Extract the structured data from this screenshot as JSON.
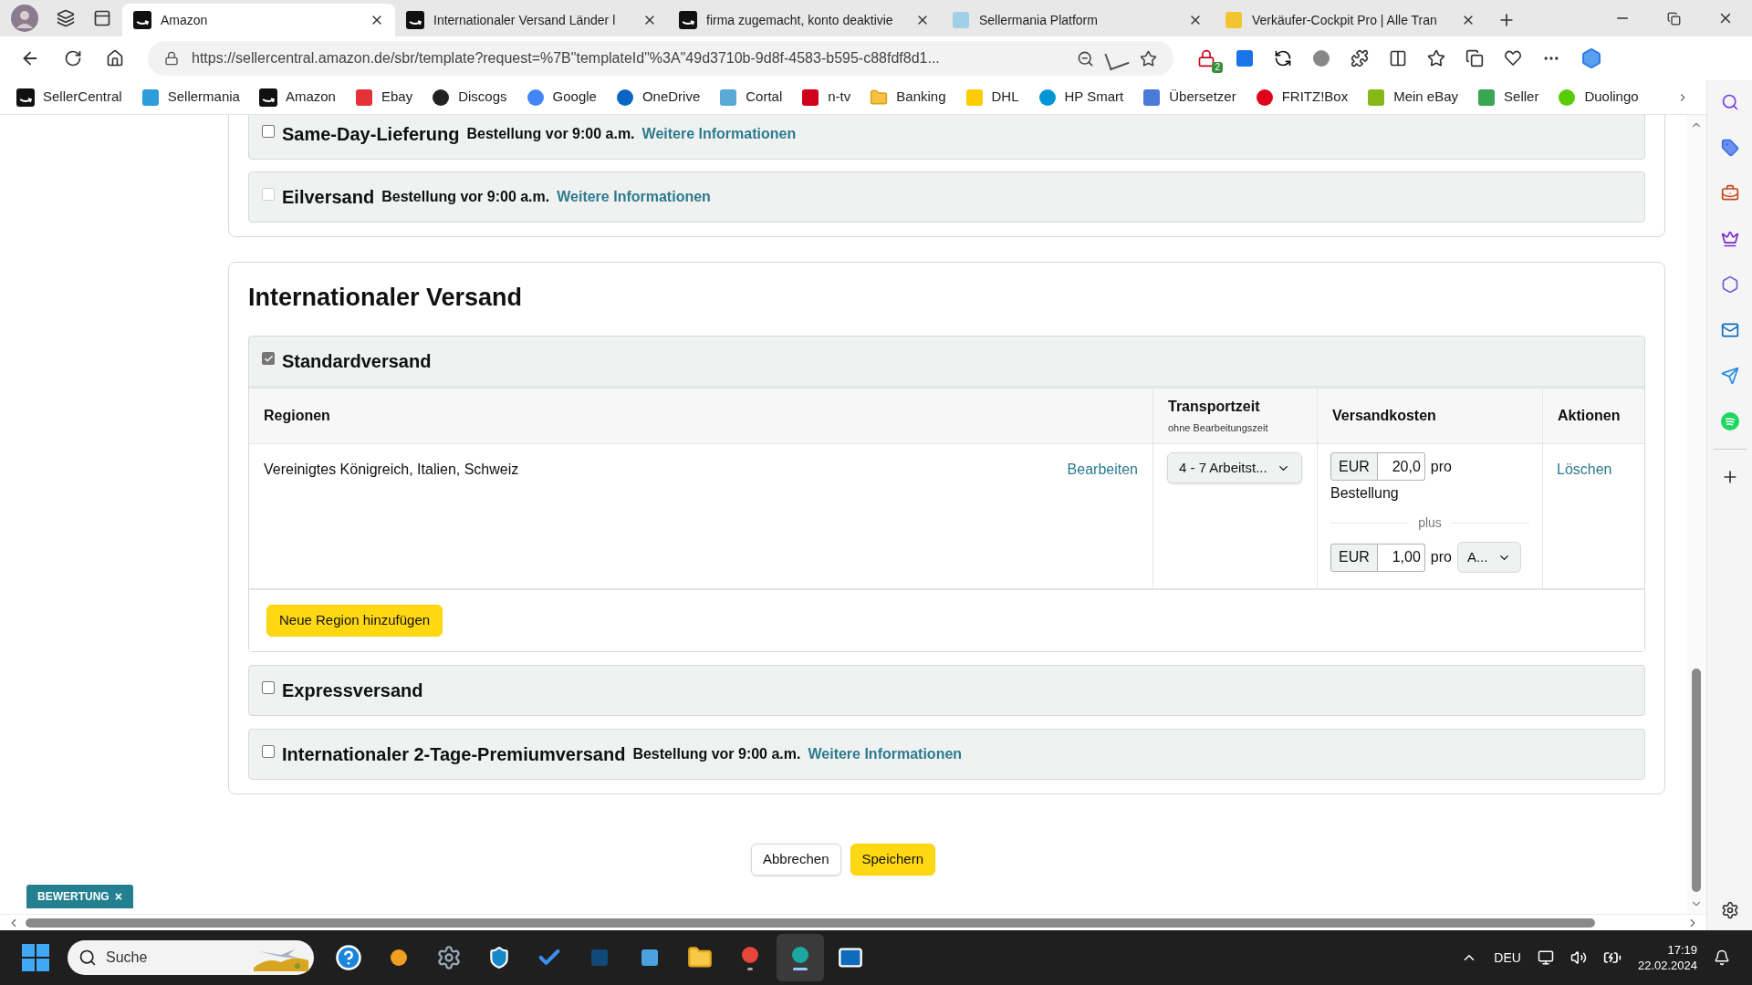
{
  "browser": {
    "tabs": [
      {
        "title": "Amazon",
        "selected": true
      },
      {
        "title": "Internationaler Versand Länder l",
        "selected": false
      },
      {
        "title": "firma zugemacht, konto deaktivie",
        "selected": false
      },
      {
        "title": "Sellermania Platform",
        "selected": false
      },
      {
        "title": "Verkäufer-Cockpit Pro | Alle Tran",
        "selected": false
      }
    ],
    "url": "https://sellercentral.amazon.de/sbr/template?request=%7B\"templateId\"%3A\"49d3710b-9d8f-4583-b595-c88fdf8d1...",
    "extension_badge": "2",
    "bookmarks": [
      "SellerCentral",
      "Sellermania",
      "Amazon",
      "Ebay",
      "Discogs",
      "Google",
      "OneDrive",
      "Cortal",
      "n-tv",
      "Banking",
      "DHL",
      "HP Smart",
      "Übersetzer",
      "FRITZ!Box",
      "Mein eBay",
      "Seller",
      "Duolingo"
    ]
  },
  "domestic_options": [
    {
      "title": "Same-Day-Lieferung",
      "note": "Bestellung vor 9:00 a.m.",
      "link": "Weitere Informationen",
      "checked": false,
      "disabled": false
    },
    {
      "title": "Eilversand",
      "note": "Bestellung vor 9:00 a.m.",
      "link": "Weitere Informationen",
      "checked": false,
      "disabled": true
    }
  ],
  "international": {
    "heading": "Internationaler Versand",
    "options": [
      {
        "title": "Standardversand",
        "checked": true,
        "expanded": true
      },
      {
        "title": "Expressversand",
        "checked": false,
        "expanded": false
      },
      {
        "title": "Internationaler 2-Tage-Premiumversand",
        "note": "Bestellung vor 9:00 a.m.",
        "link": "Weitere Informationen",
        "checked": false,
        "expanded": false
      }
    ],
    "table": {
      "columns": [
        {
          "label": "Regionen"
        },
        {
          "label": "Transportzeit",
          "sublabel": "ohne Bearbeitungszeit"
        },
        {
          "label": "Versandkosten"
        },
        {
          "label": "Aktionen"
        }
      ],
      "rows": [
        {
          "regions": "Vereinigtes Königreich, Italien, Schweiz",
          "edit": "Bearbeiten",
          "transit": "4 - 7 Arbeitst...",
          "fee": {
            "currency": "EUR",
            "value": "20,0",
            "per": "pro",
            "unit": "Bestellung"
          },
          "separator": "plus",
          "extra_fee": {
            "currency": "EUR",
            "value": "1,00",
            "per": "pro",
            "unit_select": "A..."
          },
          "delete": "Löschen"
        }
      ]
    },
    "add_button": "Neue Region hinzufügen"
  },
  "actions": {
    "cancel": "Abbrechen",
    "save": "Speichern"
  },
  "feedback_tag": {
    "label": "BEWERTUNG",
    "close": "×"
  },
  "taskbar": {
    "search_placeholder": "Suche",
    "apps": [
      {
        "running": false,
        "selected": false
      },
      {
        "running": false,
        "selected": false
      },
      {
        "running": false,
        "selected": false
      },
      {
        "running": false,
        "selected": false
      },
      {
        "running": false,
        "selected": false
      },
      {
        "running": false,
        "selected": false
      },
      {
        "running": false,
        "selected": false
      },
      {
        "running": false,
        "selected": false
      },
      {
        "running": true,
        "selected": false
      },
      {
        "running": true,
        "selected": true
      },
      {
        "running": false,
        "selected": false
      }
    ],
    "language": "DEU",
    "time": "17:19",
    "date": "22.02.2024"
  }
}
